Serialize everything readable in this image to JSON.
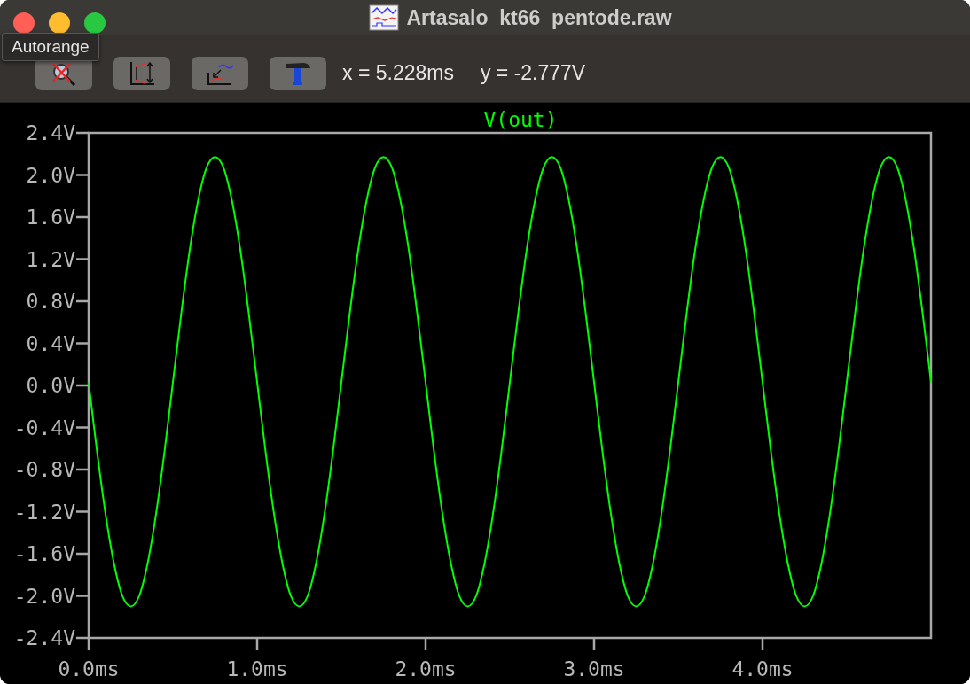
{
  "window": {
    "title": "Artasalo_kt66_pentode.raw"
  },
  "tooltip": {
    "text": "Autorange"
  },
  "toolbar": {
    "buttons": [
      {
        "kind": "autorange"
      },
      {
        "kind": "axis"
      },
      {
        "kind": "trace"
      },
      {
        "kind": "tools"
      }
    ]
  },
  "cursor": {
    "x": "x = 5.228ms",
    "y": "y = -2.777V"
  },
  "plot": {
    "chart_data": {
      "type": "line",
      "x": [
        0,
        0.05,
        0.1,
        0.15,
        0.2,
        0.25,
        0.3,
        0.35,
        0.4,
        0.45,
        0.5,
        0.55,
        0.6,
        0.65,
        0.7,
        0.75,
        0.8,
        0.85,
        0.9,
        0.95,
        1,
        1.05,
        1.1,
        1.15,
        1.2,
        1.25,
        1.3,
        1.35,
        1.4,
        1.45,
        1.5,
        1.55,
        1.6,
        1.65,
        1.7,
        1.75,
        1.8,
        1.85,
        1.9,
        1.95,
        2,
        2.05,
        2.1,
        2.15,
        2.2,
        2.25,
        2.3,
        2.35,
        2.4,
        2.45,
        2.5,
        2.55,
        2.6,
        2.65,
        2.7,
        2.75,
        2.8,
        2.85,
        2.9,
        2.95,
        3,
        3.05,
        3.1,
        3.15,
        3.2,
        3.25,
        3.3,
        3.35,
        3.4,
        3.45,
        3.5,
        3.55,
        3.6,
        3.65,
        3.7,
        3.75,
        3.8,
        3.85,
        3.9,
        3.95,
        4,
        4.05,
        4.1,
        4.15,
        4.2,
        4.25,
        4.3,
        4.35,
        4.4,
        4.45,
        4.5,
        4.55,
        4.6,
        4.65,
        4.7,
        4.75,
        4.8,
        4.85,
        4.9,
        4.95,
        5
      ],
      "series": [
        {
          "name": "V(out)",
          "color": "#00ff00",
          "values": [
            0.03,
            -0.63,
            -1.22,
            -1.69,
            -2.0,
            -2.1,
            -2.0,
            -1.69,
            -1.22,
            -0.63,
            0.03,
            0.69,
            1.29,
            1.76,
            2.07,
            2.17,
            2.07,
            1.76,
            1.29,
            0.69,
            0.03,
            -0.63,
            -1.22,
            -1.69,
            -2.0,
            -2.1,
            -2.0,
            -1.69,
            -1.22,
            -0.63,
            0.03,
            0.69,
            1.29,
            1.76,
            2.07,
            2.17,
            2.07,
            1.76,
            1.29,
            0.69,
            0.03,
            -0.63,
            -1.22,
            -1.69,
            -2.0,
            -2.1,
            -2.0,
            -1.69,
            -1.22,
            -0.63,
            0.03,
            0.69,
            1.29,
            1.76,
            2.07,
            2.17,
            2.07,
            1.76,
            1.29,
            0.69,
            0.03,
            -0.63,
            -1.22,
            -1.69,
            -2.0,
            -2.1,
            -2.0,
            -1.69,
            -1.22,
            -0.63,
            0.03,
            0.69,
            1.29,
            1.76,
            2.07,
            2.17,
            2.07,
            1.76,
            1.29,
            0.69,
            0.03,
            -0.63,
            -1.22,
            -1.69,
            -2.0,
            -2.1,
            -2.0,
            -1.69,
            -1.22,
            -0.63,
            0.03,
            0.69,
            1.29,
            1.76,
            2.07,
            2.17,
            2.07,
            1.76,
            1.29,
            0.69,
            0.03
          ]
        }
      ],
      "xlim": [
        0,
        5
      ],
      "ylim": [
        -2.4,
        2.4
      ],
      "xticks": [
        {
          "value": 0,
          "label": "0.0ms"
        },
        {
          "value": 1,
          "label": "1.0ms"
        },
        {
          "value": 2,
          "label": "2.0ms"
        },
        {
          "value": 3,
          "label": "3.0ms"
        },
        {
          "value": 4,
          "label": "4.0ms"
        }
      ],
      "yticks": [
        {
          "value": 2.4,
          "label": "2.4V"
        },
        {
          "value": 2.0,
          "label": "2.0V"
        },
        {
          "value": 1.6,
          "label": "1.6V"
        },
        {
          "value": 1.2,
          "label": "1.2V"
        },
        {
          "value": 0.8,
          "label": "0.8V"
        },
        {
          "value": 0.4,
          "label": "0.4V"
        },
        {
          "value": 0,
          "label": "0.0V"
        },
        {
          "value": -0.4,
          "label": "-0.4V"
        },
        {
          "value": -0.8,
          "label": "-0.8V"
        },
        {
          "value": -1.2,
          "label": "-1.2V"
        },
        {
          "value": -1.6,
          "label": "-1.6V"
        },
        {
          "value": -2.0,
          "label": "-2.0V"
        },
        {
          "value": -2.4,
          "label": "-2.4V"
        }
      ]
    }
  }
}
